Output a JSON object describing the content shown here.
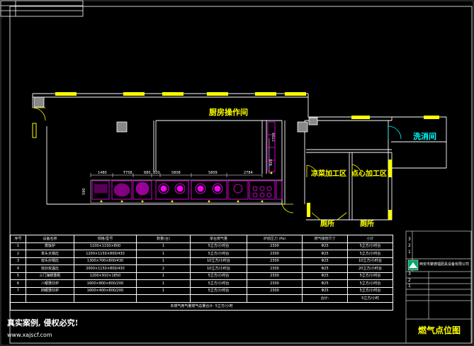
{
  "colors": {
    "background": "#000000",
    "wall": "#ffffff",
    "equipment": "#ff00ff",
    "window": "#ffff00",
    "room_text": "#ffff00",
    "wash_text": "#00ffff",
    "door": "#ffff00",
    "table_text": "#ffffff",
    "table_header": "#e8e8e8"
  },
  "rooms": {
    "kitchen": "厨房操作间",
    "wash": "洗消间",
    "cold_dish": "凉菜加工区",
    "dim_sum": "点心加工区",
    "toilet_1": "厕所",
    "toilet_2": "厕所"
  },
  "dimensions": [
    "1480",
    "T758",
    "680",
    "820",
    "5808",
    "5809",
    "2784",
    "2709",
    "590",
    "920"
  ],
  "table": {
    "headers": [
      "序号",
      "设备名称",
      "规格/型号",
      "数量(台)",
      "单台燃气量",
      "炉前压力 (Pa)",
      "燃气接管尺寸",
      "小计"
    ],
    "rows": [
      [
        "1",
        "蒸饭炉",
        "1100×1150×800",
        "1",
        "5立方/小时台",
        "2300",
        "Φ25",
        "5立方/小时台"
      ],
      [
        "2",
        "单头大锅灶",
        "1200×1150×800/430",
        "1",
        "5立方/小时台",
        "2300",
        "Φ25",
        "5立方/小时台"
      ],
      [
        "3",
        "双头炒锅灶",
        "1300×700×800/430",
        "1",
        "10立方/小时台",
        "2300",
        "Φ25",
        "10立方/小时台"
      ],
      [
        "4",
        "双炒双温灶",
        "2000×1150×800/430",
        "2",
        "10立方/小时台",
        "2300",
        "Φ25",
        "20立方/小时台"
      ],
      [
        "5",
        "三门海鲜蒸柜",
        "1200×910×1850",
        "1",
        "5立方/小时台",
        "2300",
        "Φ25",
        "5立方/小时台"
      ],
      [
        "6",
        "八眼煲仔炉",
        "1600×800×800/200",
        "1",
        "5立方/小时台",
        "2300",
        "Φ25",
        "5立方/小时台"
      ],
      [
        "7",
        "四眼煲仔炉",
        "1600×400×800/200",
        "1",
        "5立方/小时台",
        "2300",
        "Φ25",
        "5立方/小时台"
      ]
    ],
    "total_label": "合计:",
    "total_value": "5立方/小时",
    "summary": "本燃气用气量燃气总量合计: 5立方/小时"
  },
  "footer": {
    "slogan": "真实案例, 侵权必究!",
    "website": "www.xajscf.com"
  },
  "title_block": {
    "numbers": [
      "3",
      "2",
      "1",
      "3",
      "2",
      "1"
    ],
    "company_logo_text": "西安市聚德福厨具设备有限公司",
    "drawing_name": "燃气点位图"
  }
}
